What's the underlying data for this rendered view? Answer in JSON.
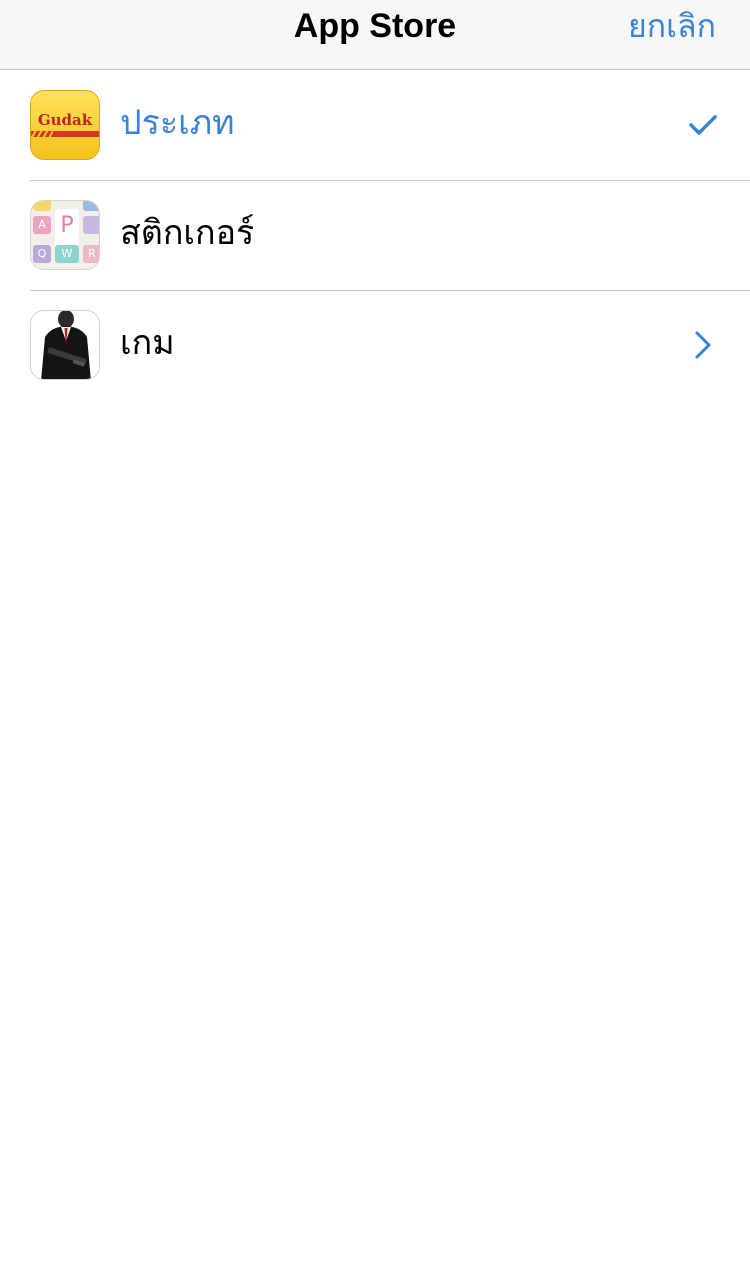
{
  "nav": {
    "title": "App Store",
    "cancel_label": "ยกเลิก"
  },
  "rows": [
    {
      "label": "ประเภท",
      "icon": "gudak-app-icon",
      "icon_text": "Gudak",
      "accessory": "checkmark-icon",
      "selected": true
    },
    {
      "label": "สติกเกอร์",
      "icon": "keyboard-sticker-app-icon",
      "accessory": null,
      "selected": false
    },
    {
      "label": "เกม",
      "icon": "agent-game-app-icon",
      "accessory": "chevron-right-icon",
      "selected": false
    }
  ],
  "colors": {
    "accent": "#3a82d6",
    "separator": "#c8c7cc",
    "nav_background": "#f7f7f7"
  }
}
